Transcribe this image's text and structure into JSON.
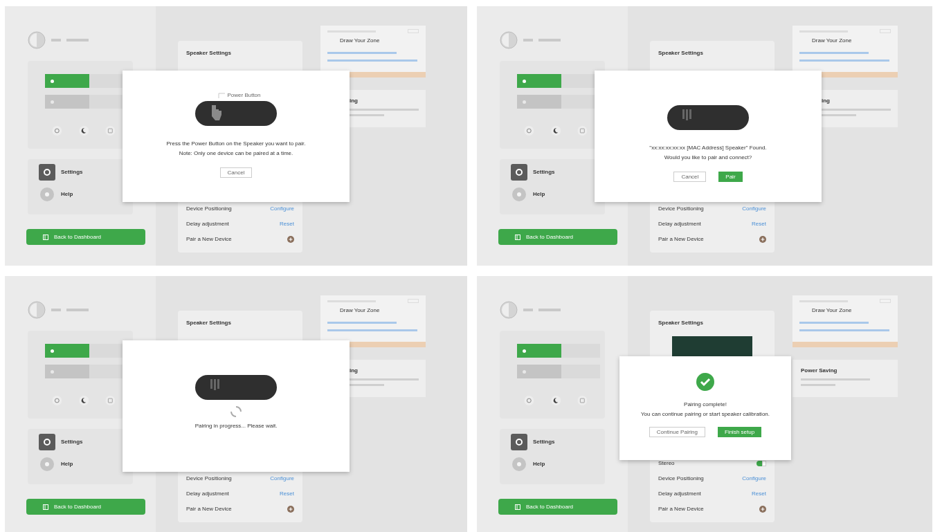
{
  "panels": [
    {
      "sidebar": {
        "menu": [
          {
            "kind": "settings",
            "label": "Settings"
          },
          {
            "kind": "help",
            "label": "Help"
          }
        ],
        "back_button": "Back to Dashboard"
      },
      "speaker_card": {
        "title": "Speaker Settings",
        "rows": [
          {
            "kind": "link",
            "label": "Device Positioning",
            "action": "Configure"
          },
          {
            "kind": "link",
            "label": "Delay adjustment",
            "action": "Reset"
          },
          {
            "kind": "add",
            "label": "Pair a New Device"
          }
        ]
      },
      "zone_card": {
        "title": "Draw Your Zone"
      },
      "power_card": {
        "title": "ing"
      },
      "modal": {
        "kind": "prompt",
        "callout": "Power Button",
        "lines": [
          "Press the Power Button on the Speaker you want to pair.",
          "Note: Only one device can be paired at a time."
        ],
        "buttons": [
          {
            "kind": "secondary",
            "label": "Cancel"
          }
        ]
      }
    },
    {
      "sidebar": {
        "menu": [
          {
            "kind": "settings",
            "label": "Settings"
          },
          {
            "kind": "help",
            "label": "Help"
          }
        ],
        "back_button": "Back to Dashboard"
      },
      "speaker_card": {
        "title": "Speaker Settings",
        "rows": [
          {
            "kind": "link",
            "label": "Device Positioning",
            "action": "Configure"
          },
          {
            "kind": "link",
            "label": "Delay adjustment",
            "action": "Reset"
          },
          {
            "kind": "add",
            "label": "Pair a New Device"
          }
        ]
      },
      "zone_card": {
        "title": "Draw Your Zone"
      },
      "power_card": {
        "title": "ing"
      },
      "modal": {
        "kind": "found",
        "lines": [
          "\"xx:xx:xx:xx:xx [MAC Address] Speaker\" Found.",
          "Would you like to pair and connect?"
        ],
        "buttons": [
          {
            "kind": "secondary",
            "label": "Cancel"
          },
          {
            "kind": "primary",
            "label": "Pair"
          }
        ]
      }
    },
    {
      "sidebar": {
        "menu": [
          {
            "kind": "settings",
            "label": "Settings"
          },
          {
            "kind": "help",
            "label": "Help"
          }
        ],
        "back_button": "Back to Dashboard"
      },
      "speaker_card": {
        "title": "Speaker Settings",
        "rows": [
          {
            "kind": "link",
            "label": "Device Positioning",
            "action": "Configure"
          },
          {
            "kind": "link",
            "label": "Delay adjustment",
            "action": "Reset"
          },
          {
            "kind": "add",
            "label": "Pair a New Device"
          }
        ]
      },
      "zone_card": {
        "title": "Draw Your Zone"
      },
      "power_card": {
        "title": "ing"
      },
      "modal": {
        "kind": "progress",
        "lines": [
          "Pairing in progress... Please wait."
        ]
      }
    },
    {
      "sidebar": {
        "menu": [
          {
            "kind": "settings",
            "label": "Settings"
          },
          {
            "kind": "help",
            "label": "Help"
          }
        ],
        "back_button": "Back to Dashboard"
      },
      "speaker_card": {
        "title": "Speaker Settings",
        "photo": true,
        "rows": [
          {
            "kind": "toggle",
            "label": "Stereo",
            "on": true
          },
          {
            "kind": "link",
            "label": "Device Positioning",
            "action": "Configure"
          },
          {
            "kind": "link",
            "label": "Delay adjustment",
            "action": "Reset"
          },
          {
            "kind": "add",
            "label": "Pair a New Device"
          }
        ]
      },
      "zone_card": {
        "title": "Draw Your Zone"
      },
      "power_card": {
        "title": "Power Saving"
      },
      "modal": {
        "kind": "complete",
        "lines": [
          "Pairing complete!",
          "You can continue pairing or start speaker calibration."
        ],
        "buttons": [
          {
            "kind": "secondary",
            "label": "Continue Pairing"
          },
          {
            "kind": "primary",
            "label": "Finish setup"
          }
        ]
      }
    }
  ]
}
